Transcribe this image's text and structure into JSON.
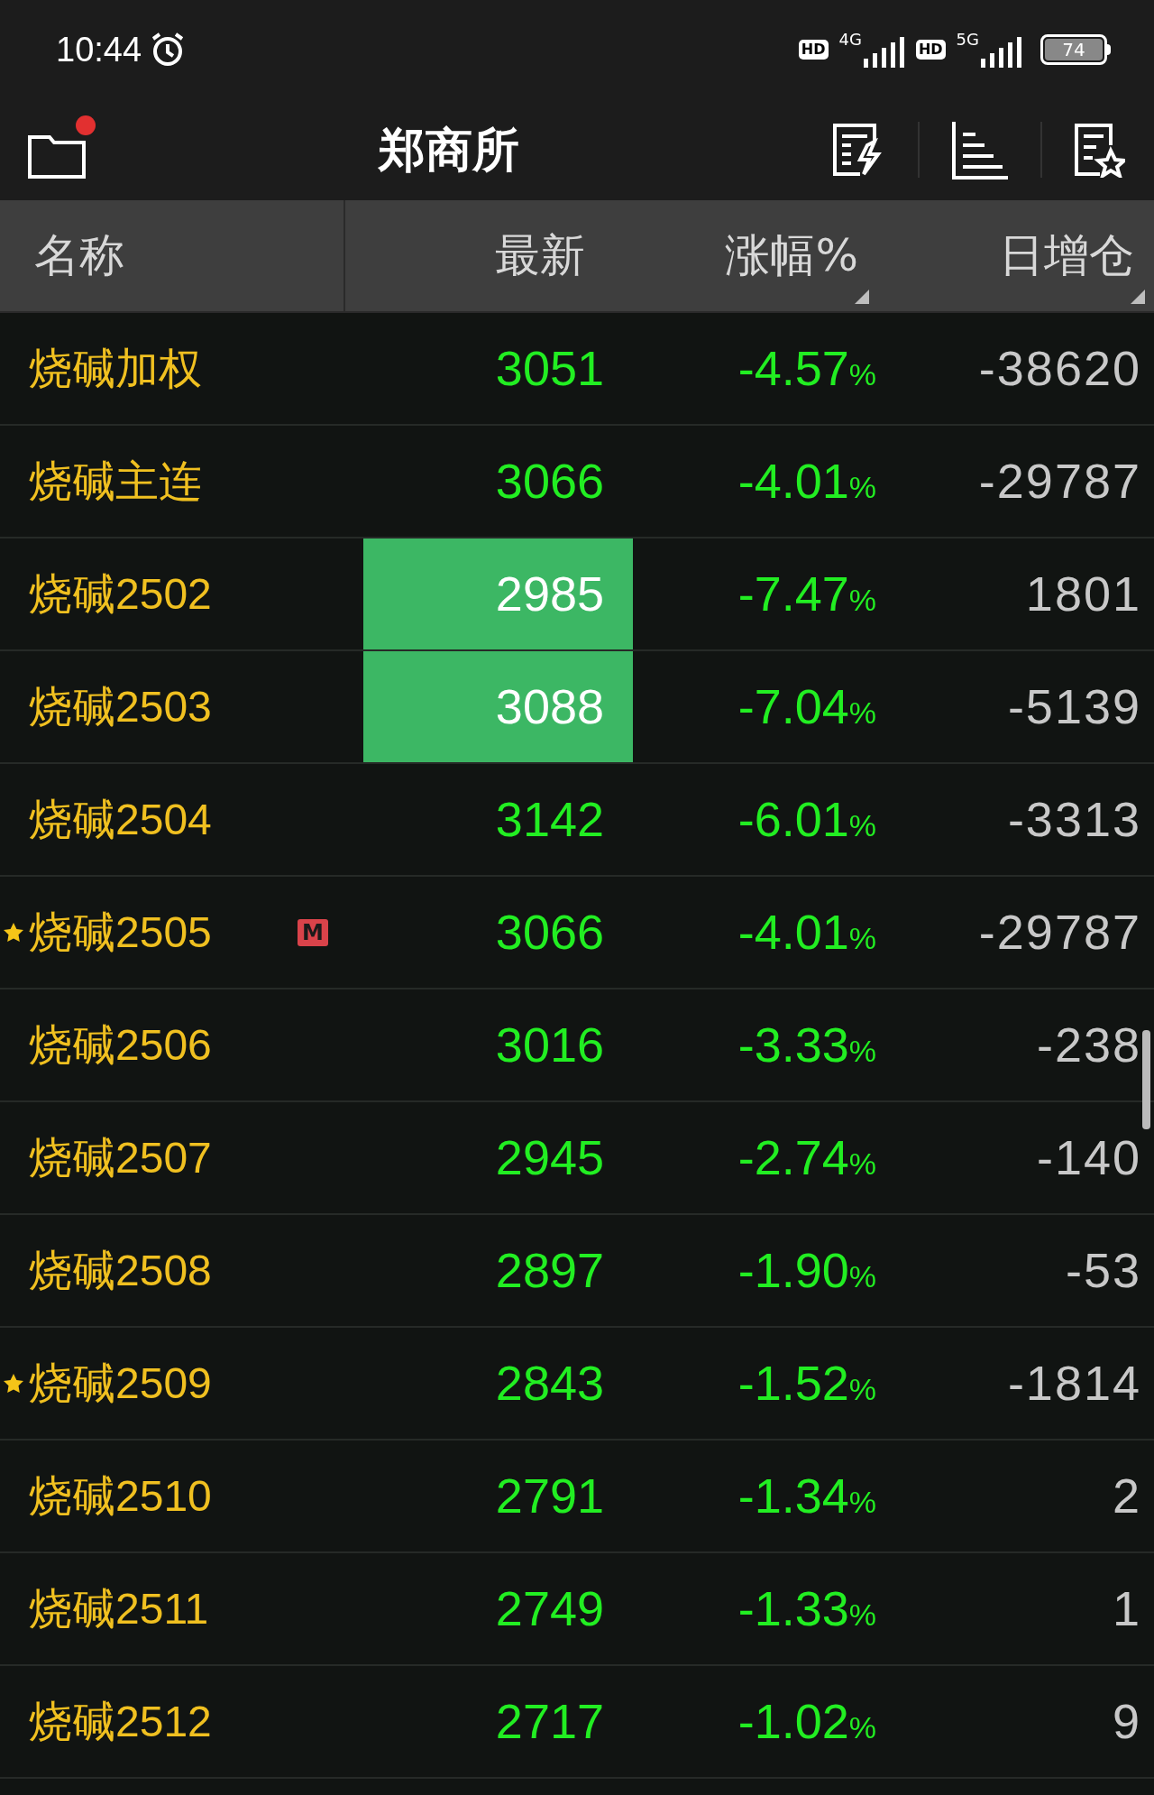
{
  "status_bar": {
    "time": "10:44",
    "sim1": {
      "hd": "HD",
      "network": "4G"
    },
    "sim2": {
      "hd": "HD",
      "network": "5G"
    },
    "battery": "74"
  },
  "header": {
    "title": "郑商所",
    "notification_dot": true
  },
  "table": {
    "columns": [
      {
        "label": "名称",
        "sortable": false
      },
      {
        "label": "最新",
        "sortable": false
      },
      {
        "label": "涨幅%",
        "sortable": true
      },
      {
        "label": "日增仓",
        "sortable": true
      }
    ],
    "rows": [
      {
        "name": "烧碱加权",
        "starred": false,
        "price": "3051",
        "highlighted": false,
        "change": "-4.57%",
        "oi_change": "-38620"
      },
      {
        "name": "烧碱主连",
        "starred": false,
        "price": "3066",
        "highlighted": false,
        "change": "-4.01%",
        "oi_change": "-29787"
      },
      {
        "name": "烧碱2502",
        "starred": false,
        "price": "2985",
        "highlighted": true,
        "change": "-7.47%",
        "oi_change": "1801"
      },
      {
        "name": "烧碱2503",
        "starred": false,
        "price": "3088",
        "highlighted": true,
        "change": "-7.04%",
        "oi_change": "-5139"
      },
      {
        "name": "烧碱2504",
        "starred": false,
        "price": "3142",
        "highlighted": false,
        "change": "-6.01%",
        "oi_change": "-3313"
      },
      {
        "name": "烧碱2505",
        "starred": true,
        "badge": "M",
        "price": "3066",
        "highlighted": false,
        "change": "-4.01%",
        "oi_change": "-29787"
      },
      {
        "name": "烧碱2506",
        "starred": false,
        "price": "3016",
        "highlighted": false,
        "change": "-3.33%",
        "oi_change": "-238"
      },
      {
        "name": "烧碱2507",
        "starred": false,
        "price": "2945",
        "highlighted": false,
        "change": "-2.74%",
        "oi_change": "-140"
      },
      {
        "name": "烧碱2508",
        "starred": false,
        "price": "2897",
        "highlighted": false,
        "change": "-1.90%",
        "oi_change": "-53"
      },
      {
        "name": "烧碱2509",
        "starred": true,
        "price": "2843",
        "highlighted": false,
        "change": "-1.52%",
        "oi_change": "-1814"
      },
      {
        "name": "烧碱2510",
        "starred": false,
        "price": "2791",
        "highlighted": false,
        "change": "-1.34%",
        "oi_change": "2"
      },
      {
        "name": "烧碱2511",
        "starred": false,
        "price": "2749",
        "highlighted": false,
        "change": "-1.33%",
        "oi_change": "1"
      },
      {
        "name": "烧碱2512",
        "starred": false,
        "price": "2717",
        "highlighted": false,
        "change": "-1.02%",
        "oi_change": "9"
      }
    ]
  }
}
